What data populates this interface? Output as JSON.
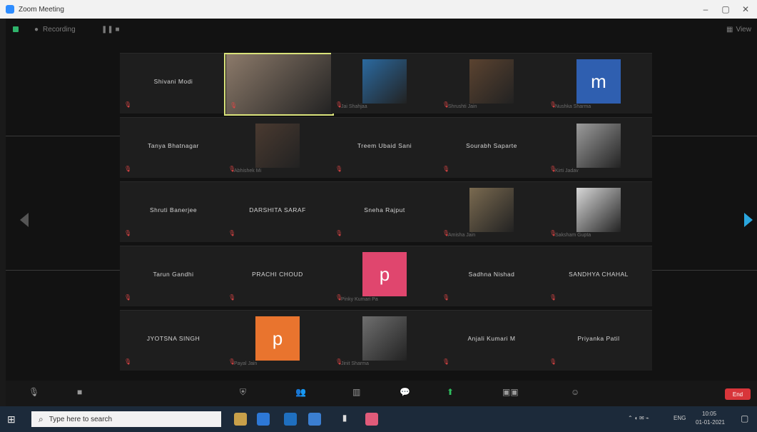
{
  "window": {
    "title": "Zoom Meeting",
    "controls": {
      "min": "–",
      "max": "▢",
      "close": "✕"
    }
  },
  "topbar": {
    "recording": "Recording",
    "view": "View"
  },
  "participants": [
    {
      "id": "p1",
      "type": "name",
      "name": "Shivani Modi",
      "caption": ""
    },
    {
      "id": "p2",
      "type": "video",
      "name": "",
      "caption": "",
      "active": true,
      "color": "#8c7a6a"
    },
    {
      "id": "p3",
      "type": "photo",
      "name": "",
      "caption": "Jai Shahjaa",
      "color": "#2b6aa0"
    },
    {
      "id": "p4",
      "type": "photo",
      "name": "",
      "caption": "Shrushti Jain",
      "color": "#5b4330"
    },
    {
      "id": "p5",
      "type": "letter",
      "name": "",
      "caption": "Nushka Sharma",
      "letter": "m",
      "color": "#2f5fb0"
    },
    {
      "id": "p6",
      "type": "name",
      "name": "Tanya Bhatnagar",
      "caption": ""
    },
    {
      "id": "p7",
      "type": "photo",
      "name": "",
      "caption": "Abhishek Mi",
      "color": "#4a3a30"
    },
    {
      "id": "p8",
      "type": "name",
      "name": "Treem Ubaid Sani",
      "caption": ""
    },
    {
      "id": "p9",
      "type": "name",
      "name": "Sourabh Saparte",
      "caption": ""
    },
    {
      "id": "p10",
      "type": "photo",
      "name": "",
      "caption": "Kirti Jadav",
      "color": "#9c9c9c"
    },
    {
      "id": "p11",
      "type": "name",
      "name": "Shruti Banerjee",
      "caption": ""
    },
    {
      "id": "p12",
      "type": "name",
      "name": "DARSHITA SARAF",
      "caption": ""
    },
    {
      "id": "p13",
      "type": "name",
      "name": "Sneha Rajput",
      "caption": ""
    },
    {
      "id": "p14",
      "type": "photo",
      "name": "",
      "caption": "Amisha Jain",
      "color": "#7a6a50"
    },
    {
      "id": "p15",
      "type": "photo",
      "name": "",
      "caption": "Saksham Gupta",
      "color": "#d8d8d8"
    },
    {
      "id": "p16",
      "type": "name",
      "name": "Tarun Gandhi",
      "caption": ""
    },
    {
      "id": "p17",
      "type": "name",
      "name": "PRACHI CHOUD",
      "caption": ""
    },
    {
      "id": "p18",
      "type": "letter",
      "name": "",
      "caption": "Pinky Kumari Pa",
      "letter": "p",
      "color": "#e0466e"
    },
    {
      "id": "p19",
      "type": "name",
      "name": "Sadhna Nishad",
      "caption": ""
    },
    {
      "id": "p20",
      "type": "name",
      "name": "SANDHYA CHAHAL",
      "caption": ""
    },
    {
      "id": "p21",
      "type": "name",
      "name": "JYOTSNA SINGH",
      "caption": ""
    },
    {
      "id": "p22",
      "type": "letter",
      "name": "",
      "caption": "Payal Jain",
      "letter": "p",
      "color": "#e9742e"
    },
    {
      "id": "p23",
      "type": "photo",
      "name": "",
      "caption": "Jinit Sharma",
      "color": "#6f6f6f"
    },
    {
      "id": "p24",
      "type": "name",
      "name": "Anjali Kumari M",
      "caption": ""
    },
    {
      "id": "p25",
      "type": "name",
      "name": "Priyanka Patil",
      "caption": ""
    }
  ],
  "toolbar": {
    "end_label": "End"
  },
  "taskbar": {
    "search_placeholder": "Type here to search",
    "tray_time": "10:05",
    "tray_date": "01-01-2021",
    "tray_lang": "ENG"
  }
}
